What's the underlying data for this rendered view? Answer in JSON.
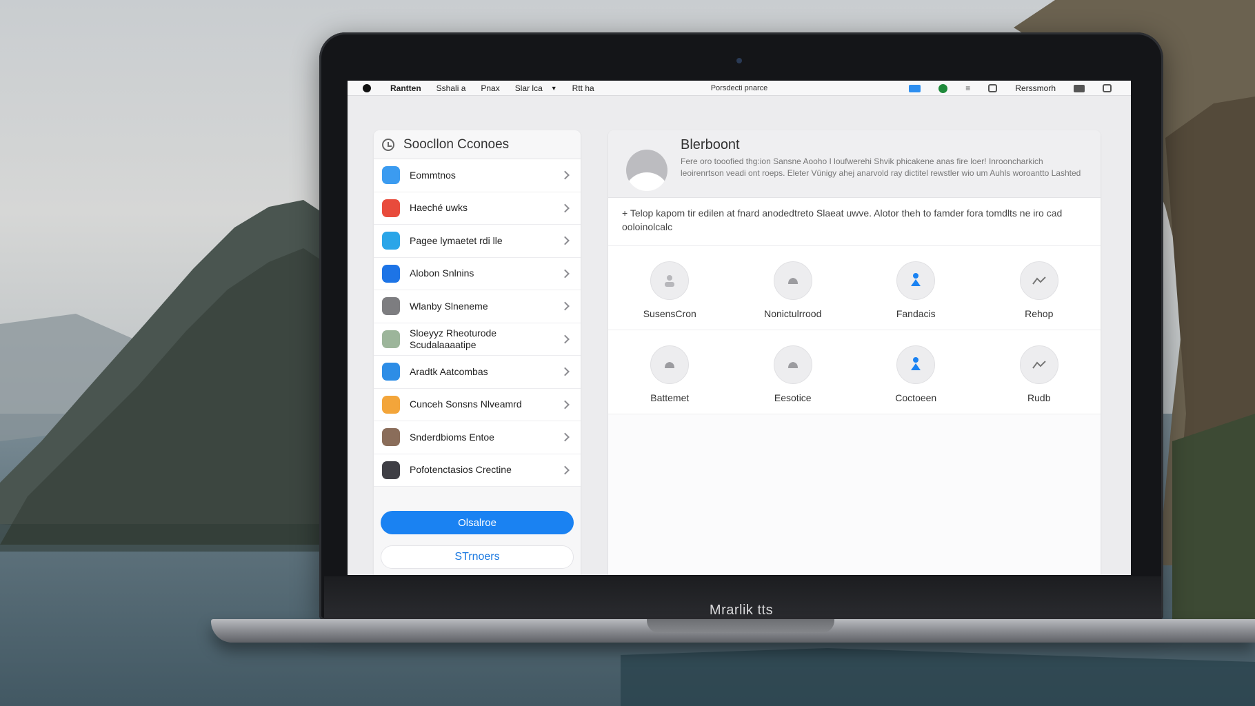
{
  "menubar": {
    "items": [
      "Rantten",
      "Sshali a",
      "Pnax",
      "Slar lca",
      "Rtt ha"
    ],
    "center_title": "Porsdecti pnarce",
    "right_label": "Rerssmorh"
  },
  "sidebar": {
    "title": "Soocllon Cconoes",
    "items": [
      {
        "label": "Eommtnos",
        "color": "#3b9bf0"
      },
      {
        "label": "Haeché uwks",
        "color": "#e84b3c"
      },
      {
        "label": "Pagee lymaetet rdi lle",
        "color": "#2aa5e8"
      },
      {
        "label": "Alobon Snlnins",
        "color": "#1d74e6"
      },
      {
        "label": "Wlanby Slneneme",
        "color": "#7d7d80"
      },
      {
        "label": "Sloeyyz Rheoturode Scudalaaaatipe",
        "color": "#9cb59a"
      },
      {
        "label": "Aradtk Aatcombas",
        "color": "#2d8de6"
      },
      {
        "label": "Cunceh Sonsns Nlveamrd",
        "color": "#f3a53a"
      },
      {
        "label": "Snderdbioms Entoe",
        "color": "#8a6d5a"
      },
      {
        "label": "Pofotenctasios Crectine",
        "color": "#3f3f45"
      }
    ],
    "primary_button": "Olsalroe",
    "secondary_button": "STrnoers"
  },
  "panel": {
    "title": "Blerboont",
    "description": "Fere oro tooofied thg:ion Sansne Aooho I loufwerehi Shvik phicakene anas fire loer! Inrooncharkich leoirenrtson veadi ont roeps. Eleter Vünigy ahej anarvold ray dictitel rewstler wio um Auhls woroantto Lashted",
    "notice": "+ Telop  kapom tir edilen at fnard anodedtreto Slaeat uwve. Alotor theh to famder fora tomdlts ne iro cad ooloinolcalc",
    "tiles_row1": [
      {
        "label": "SusensCron",
        "icon": "person-icon"
      },
      {
        "label": "Nonictulrrood",
        "icon": "cloud-icon"
      },
      {
        "label": "Fandacis",
        "icon": "person-blue-icon"
      },
      {
        "label": "Rehop",
        "icon": "trend-icon"
      }
    ],
    "tiles_row2": [
      {
        "label": "Battemet",
        "icon": "cloud-icon"
      },
      {
        "label": "Eesotice",
        "icon": "cloud-icon"
      },
      {
        "label": "Coctoeen",
        "icon": "person-blue-icon"
      },
      {
        "label": "Rudb",
        "icon": "trend-icon"
      }
    ]
  },
  "laptop": {
    "brand": "Mrarlik tts"
  },
  "colors": {
    "accent": "#1a82f2",
    "menu_icon_blue": "#2d8ef0",
    "menu_icon_green": "#1f8a3b"
  }
}
